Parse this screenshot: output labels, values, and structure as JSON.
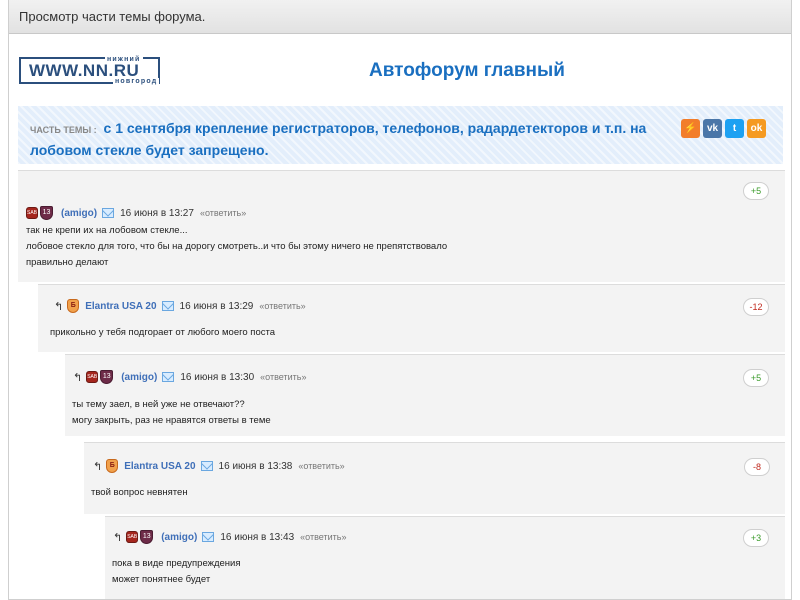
{
  "window": {
    "title": "Просмотр части темы форума."
  },
  "header": {
    "logo_top": "нижний",
    "logo_main": "WWW.NN.RU",
    "logo_bottom": "новгород",
    "forum_title": "Автофорум главный"
  },
  "topic": {
    "prefix": "ЧАСТЬ ТЕМЫ :",
    "title": "с 1 сентября крепление регистраторов, телефонов, радардетекторов и т.п. на лобовом стекле будет запрещено."
  },
  "share": [
    {
      "name": "share-lightning-icon",
      "glyph": "⚡",
      "color": "#f27d2a"
    },
    {
      "name": "vk-icon",
      "glyph": "vk",
      "color": "#4a76a8"
    },
    {
      "name": "twitter-icon",
      "glyph": "t",
      "color": "#1da1f2"
    },
    {
      "name": "odnoklassniki-icon",
      "glyph": "ok",
      "color": "#f59a21"
    }
  ],
  "posts": [
    {
      "author": "(amigo)",
      "date": "16 июня в 13:27",
      "reply": "«ответить»",
      "rating": "+5",
      "lines": [
        "так не крепи их на лобовом стекле...",
        "лобовое стекло для того, что бы на дорогу смотреть..и что бы этому ничего не препятствовало",
        "правильно делают"
      ],
      "avatar_car": "SAB",
      "avatar_num": "13"
    },
    {
      "author": "Elantra USA 20",
      "date": "16 июня в 13:29",
      "reply": "«ответить»",
      "rating": "-12",
      "lines": [
        "прикольно у тебя подгорает от любого моего поста"
      ],
      "avatar_flag": "Б"
    },
    {
      "author": "(amigo)",
      "date": "16 июня в 13:30",
      "reply": "«ответить»",
      "rating": "+5",
      "lines": [
        "ты тему заел, в ней уже не отвечают??",
        "могу закрыть, раз не нравятся ответы в теме"
      ],
      "avatar_car": "SAB",
      "avatar_num": "13"
    },
    {
      "author": "Elantra USA 20",
      "date": "16 июня в 13:38",
      "reply": "«ответить»",
      "rating": "-8",
      "lines": [
        "твой вопрос невнятен"
      ],
      "avatar_flag": "Б"
    },
    {
      "author": "(amigo)",
      "date": "16 июня в 13:43",
      "reply": "«ответить»",
      "rating": "+3",
      "lines": [
        "пока в виде предупреждения",
        "может понятнее будет"
      ],
      "avatar_car": "SAB",
      "avatar_num": "13"
    }
  ],
  "reply_arrow": "↰"
}
